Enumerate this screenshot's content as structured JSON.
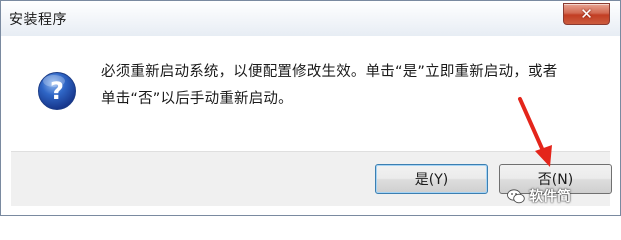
{
  "window": {
    "title": "安装程序",
    "close_symbol": "✕"
  },
  "dialog": {
    "icon": "question-icon",
    "message_lines": [
      "必须重新启动系统，以便配置修改生效。单击“是”立即重新启动，或者",
      "单击“否”以后手动重新启动。"
    ]
  },
  "buttons": {
    "yes_label": "是(Y)",
    "no_label": "否(N)"
  },
  "overlay": {
    "watermark_text": "软件简",
    "watermark_icon": "wechat-icon",
    "arrow_color": "#e4251b"
  }
}
